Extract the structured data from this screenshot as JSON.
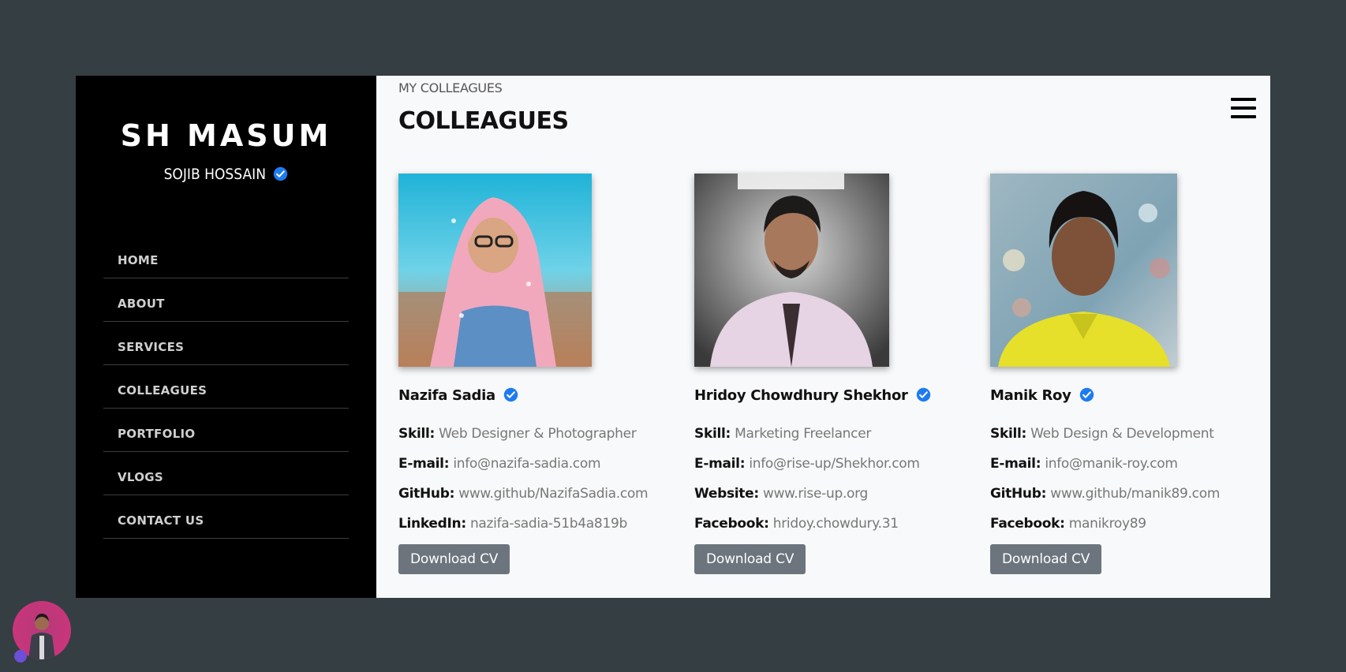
{
  "sidebar": {
    "brand": "SH MASUM",
    "subname": "SOJIB HOSSAIN",
    "nav": [
      "HOME",
      "ABOUT",
      "SERVICES",
      "COLLEAGUES",
      "PORTFOLIO",
      "VLOGS",
      "CONTACT US"
    ]
  },
  "main": {
    "breadcrumb": "MY COLLEAGUES",
    "title": "COLLEAGUES",
    "cards": [
      {
        "name": "Nazifa Sadia",
        "fields": [
          {
            "label": "Skill:",
            "value": "Web Designer & Photographer"
          },
          {
            "label": "E-mail:",
            "value": "info@nazifa-sadia.com"
          },
          {
            "label": "GitHub:",
            "value": "www.github/NazifaSadia.com"
          },
          {
            "label": "LinkedIn:",
            "value": "nazifa-sadia-51b4a819b"
          }
        ],
        "button": "Download CV"
      },
      {
        "name": "Hridoy Chowdhury Shekhor",
        "fields": [
          {
            "label": "Skill:",
            "value": "Marketing Freelancer"
          },
          {
            "label": "E-mail:",
            "value": "info@rise-up/Shekhor.com"
          },
          {
            "label": "Website:",
            "value": "www.rise-up.org"
          },
          {
            "label": "Facebook:",
            "value": "hridoy.chowdury.31"
          }
        ],
        "button": "Download CV"
      },
      {
        "name": "Manik Roy",
        "fields": [
          {
            "label": "Skill:",
            "value": "Web Design & Development"
          },
          {
            "label": "E-mail:",
            "value": "info@manik-roy.com"
          },
          {
            "label": "GitHub:",
            "value": "www.github/manik89.com"
          },
          {
            "label": "Facebook:",
            "value": "manikroy89"
          }
        ],
        "button": "Download CV"
      }
    ]
  },
  "colors": {
    "background": "#353e42",
    "sidebar": "#000000",
    "main": "#f8f9fa",
    "verified": "#1d7bf0",
    "button": "#6c757d"
  }
}
